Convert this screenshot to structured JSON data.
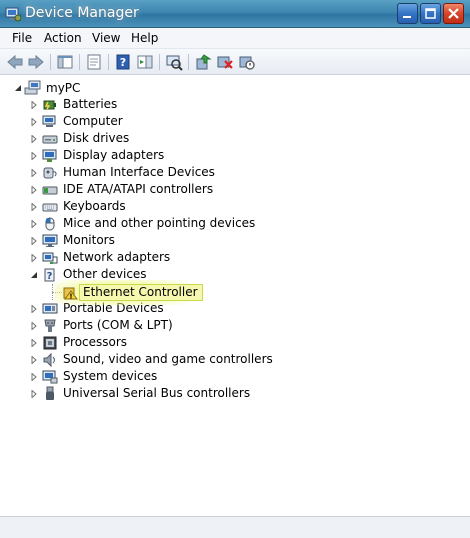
{
  "window": {
    "title": "Device Manager"
  },
  "menu": {
    "file": "File",
    "action": "Action",
    "view": "View",
    "help": "Help"
  },
  "toolbar": {
    "buttons": [
      "back-icon",
      "forward-icon",
      "show-hide-console-tree-icon",
      "properties-icon",
      "help-icon",
      "action-pane-icon",
      "scan-hardware-icon",
      "update-driver-icon",
      "uninstall-icon",
      "disable-device-icon"
    ]
  },
  "tree": {
    "root": "myPC",
    "categories": [
      {
        "label": "Batteries",
        "icon": "battery-icon"
      },
      {
        "label": "Computer",
        "icon": "computer-icon"
      },
      {
        "label": "Disk drives",
        "icon": "disk-drive-icon"
      },
      {
        "label": "Display adapters",
        "icon": "display-adapter-icon"
      },
      {
        "label": "Human Interface Devices",
        "icon": "hid-icon"
      },
      {
        "label": "IDE ATA/ATAPI controllers",
        "icon": "ide-controller-icon"
      },
      {
        "label": "Keyboards",
        "icon": "keyboard-icon"
      },
      {
        "label": "Mice and other pointing devices",
        "icon": "mouse-icon"
      },
      {
        "label": "Monitors",
        "icon": "monitor-icon"
      },
      {
        "label": "Network adapters",
        "icon": "network-adapter-icon"
      },
      {
        "label": "Other devices",
        "icon": "other-devices-icon",
        "expanded": true
      },
      {
        "label": "Portable Devices",
        "icon": "portable-device-icon"
      },
      {
        "label": "Ports (COM & LPT)",
        "icon": "port-icon"
      },
      {
        "label": "Processors",
        "icon": "processor-icon"
      },
      {
        "label": "Sound, video and game controllers",
        "icon": "sound-icon"
      },
      {
        "label": "System devices",
        "icon": "system-device-icon"
      },
      {
        "label": "Universal Serial Bus controllers",
        "icon": "usb-icon"
      }
    ],
    "selected_child": {
      "label": "Ethernet Controller",
      "icon": "warning-device-icon"
    }
  },
  "colors": {
    "titlebar": "#3d86b0",
    "highlight": "#f7f8b0",
    "highlight_border": "#c8d94a"
  }
}
